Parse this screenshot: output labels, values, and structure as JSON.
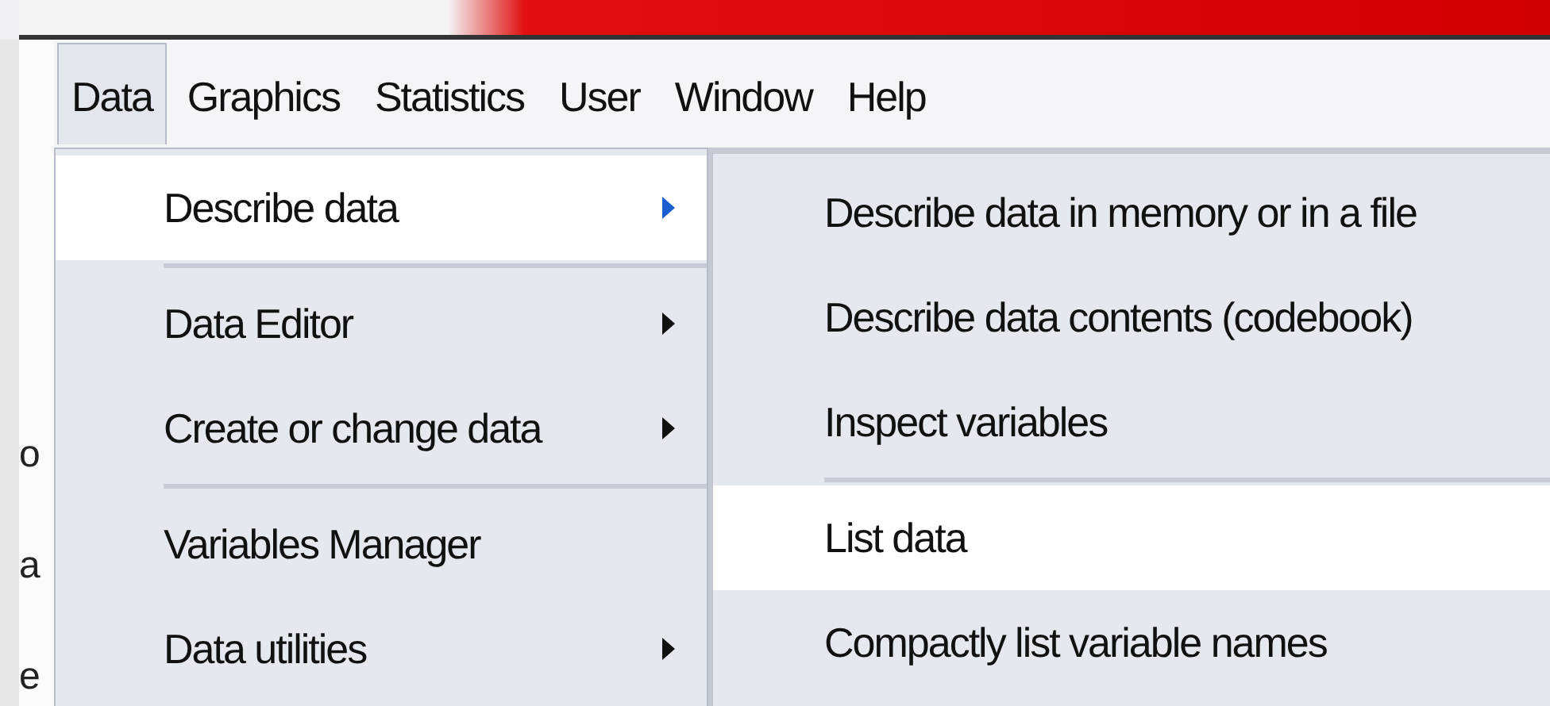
{
  "left_edge": {
    "fragments": [
      "o",
      "a",
      "e"
    ]
  },
  "menu_bar": [
    {
      "label": "Data",
      "selected": true
    },
    {
      "label": "Graphics",
      "selected": false
    },
    {
      "label": "Statistics",
      "selected": false
    },
    {
      "label": "User",
      "selected": false
    },
    {
      "label": "Window",
      "selected": false
    },
    {
      "label": "Help",
      "selected": false
    }
  ],
  "dropdown": {
    "items": [
      {
        "kind": "submenu",
        "label": "Describe data",
        "selected": true
      },
      {
        "kind": "separator"
      },
      {
        "kind": "submenu",
        "label": "Data Editor",
        "selected": false
      },
      {
        "kind": "submenu",
        "label": "Create or change data",
        "selected": false
      },
      {
        "kind": "separator"
      },
      {
        "kind": "item",
        "label": "Variables Manager",
        "selected": false
      },
      {
        "kind": "submenu",
        "label": "Data utilities",
        "selected": false
      }
    ]
  },
  "submenu": {
    "items": [
      {
        "kind": "item",
        "label": "Describe data in memory or in a file",
        "selected": false
      },
      {
        "kind": "item",
        "label": "Describe data contents (codebook)",
        "selected": false
      },
      {
        "kind": "item",
        "label": "Inspect variables",
        "selected": false
      },
      {
        "kind": "separator"
      },
      {
        "kind": "item",
        "label": "List data",
        "selected": true
      },
      {
        "kind": "item",
        "label": "Compactly list variable names",
        "selected": false
      }
    ]
  }
}
